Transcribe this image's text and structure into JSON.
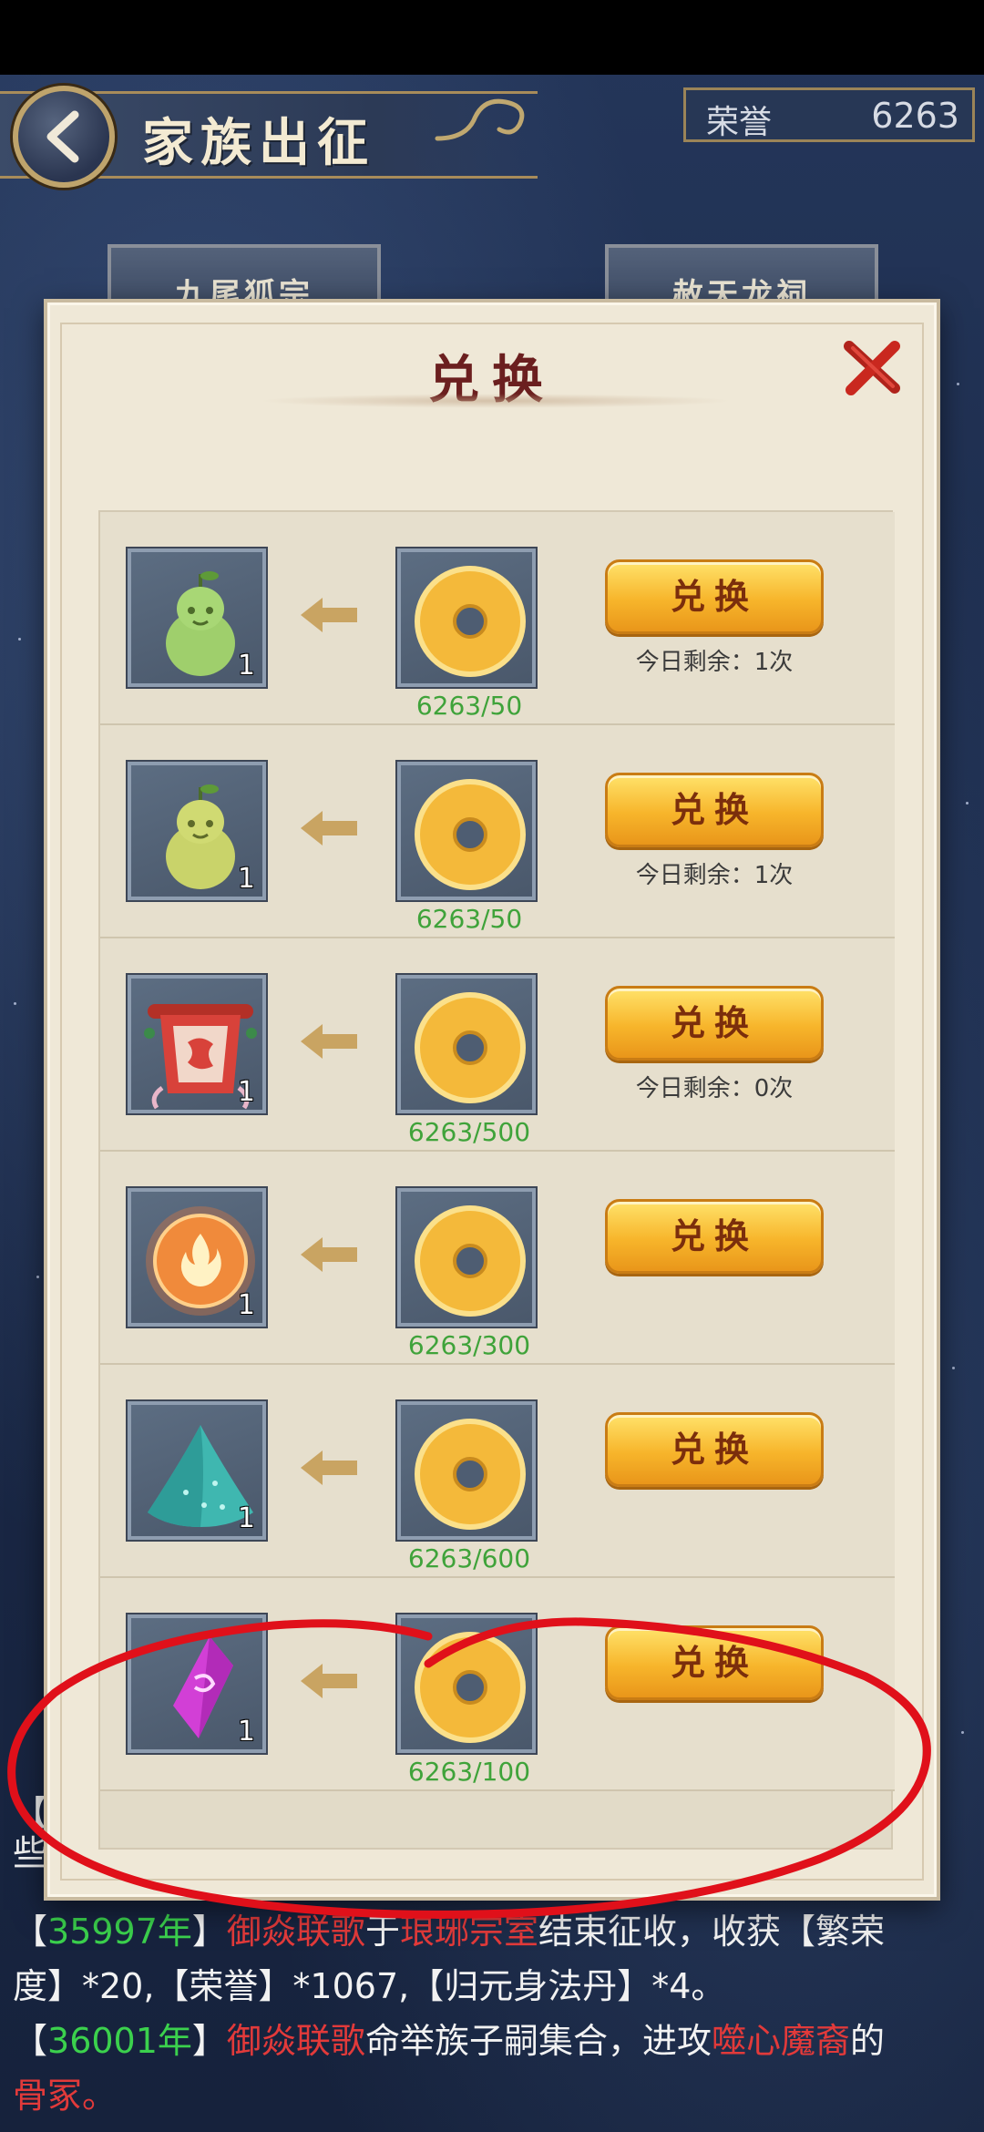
{
  "header": {
    "title": "家族出征",
    "honor_label": "荣誉",
    "honor_value": "6263"
  },
  "background_tabs": [
    {
      "label": "九尾狐宗"
    },
    {
      "label": "赦天龙祠"
    }
  ],
  "modal": {
    "title": "兑换",
    "rows": [
      {
        "item_icon": "green-pear-fruit-icon",
        "item_qty": "1",
        "cost_icon": "gold-ring-coin-icon",
        "cost": "6263/50",
        "button": "兑换",
        "remaining": "今日剩余：1次"
      },
      {
        "item_icon": "yellow-pear-fruit-icon",
        "item_qty": "1",
        "cost_icon": "gold-ring-coin-icon",
        "cost": "6263/50",
        "button": "兑换",
        "remaining": "今日剩余：1次"
      },
      {
        "item_icon": "red-scroll-banner-icon",
        "item_qty": "1",
        "cost_icon": "gold-ring-coin-icon",
        "cost": "6263/500",
        "button": "兑换",
        "remaining": "今日剩余：0次"
      },
      {
        "item_icon": "fire-orb-icon",
        "item_qty": "1",
        "cost_icon": "gold-ring-coin-icon",
        "cost": "6263/300",
        "button": "兑换",
        "remaining": ""
      },
      {
        "item_icon": "teal-crystal-pile-icon",
        "item_qty": "1",
        "cost_icon": "gold-ring-coin-icon",
        "cost": "6263/600",
        "button": "兑换",
        "remaining": ""
      },
      {
        "item_icon": "purple-crystal-icon",
        "item_qty": "1",
        "cost_icon": "gold-ring-coin-icon",
        "cost": "6263/100",
        "button": "兑换",
        "remaining": ""
      }
    ]
  },
  "log": {
    "line0_start": "【",
    "line1": "些",
    "entry1": {
      "open": "【",
      "year": "35997年",
      "close": "】",
      "clan": "御焱联歌",
      "mid": "于",
      "place": "琅琊宗室",
      "rest": "结束征收，收获【繁荣",
      "line2": "度】*20,【荣誉】*1067,【归元身法丹】*4。"
    },
    "entry2": {
      "open": "【",
      "year": "36001年",
      "close": "】",
      "clan": "御焱联歌",
      "mid": "命举族子嗣集合，进攻",
      "target": "噬心魔裔",
      "tail": "的",
      "line2": "骨冢。"
    }
  },
  "colors": {
    "accent_gold": "#f7b52b",
    "cost_green": "#3fa33a",
    "title_red": "#6b1f1f",
    "log_year_green": "#3bd14d",
    "log_name_red": "#e23a3a",
    "annotation_red": "#e0101a"
  }
}
